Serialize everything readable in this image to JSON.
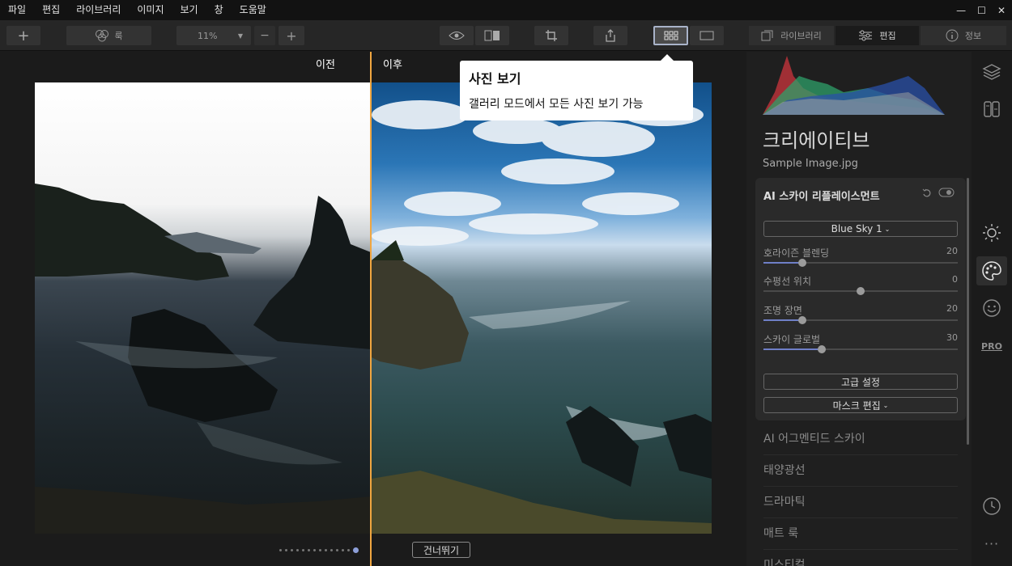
{
  "menu": [
    "파일",
    "편집",
    "라이브러리",
    "이미지",
    "보기",
    "창",
    "도움말"
  ],
  "window_controls": {
    "minimize": "—",
    "maximize": "☐",
    "close": "✕"
  },
  "toolbar": {
    "add": "+",
    "looks_label": "룩",
    "zoom_value": "11%",
    "zoom_out": "−",
    "zoom_in": "+",
    "tabs": {
      "library": "라이브러리",
      "edit": "편집",
      "info": "정보"
    }
  },
  "canvas": {
    "before_label": "이전",
    "after_label": "이후",
    "skip_label": "건너뛰기",
    "pager_total": 14,
    "pager_current": 14
  },
  "tooltip": {
    "title": "사진 보기",
    "body": "갤러리 모드에서 모든 사진 보기 가능"
  },
  "panel": {
    "title": "크리에이티브",
    "file_name": "Sample Image.jpg",
    "tool": {
      "name": "AI 스카이 리플레이스먼트",
      "sky_preset": "Blue Sky 1",
      "sliders": [
        {
          "label": "호라이즌 블렌딩",
          "value": "20",
          "min": 0,
          "max": 100,
          "pos": 20
        },
        {
          "label": "수평선 위치",
          "value": "0",
          "min": -100,
          "max": 100,
          "pos": 0
        },
        {
          "label": "조명 장면",
          "value": "20",
          "min": 0,
          "max": 100,
          "pos": 20
        },
        {
          "label": "스카이 글로벌",
          "value": "30",
          "min": 0,
          "max": 100,
          "pos": 30
        }
      ],
      "advanced_label": "고급 설정",
      "mask_label": "마스크 편집"
    },
    "tools": [
      "AI 어그멘티드 스카이",
      "태양광선",
      "드라마틱",
      "매트 룩",
      "미스티컬"
    ]
  },
  "sidebar_icons": [
    "layers-icon",
    "presets-icon",
    "sun-icon",
    "palette-icon",
    "smile-icon",
    "pro-icon",
    "history-icon",
    "more-icon"
  ],
  "pro_text": "PRO",
  "more_text": "···",
  "colors": {
    "accent": "#f0a640",
    "slider_fill": "#6f7fc7",
    "active_view": "#a9b3c9"
  }
}
